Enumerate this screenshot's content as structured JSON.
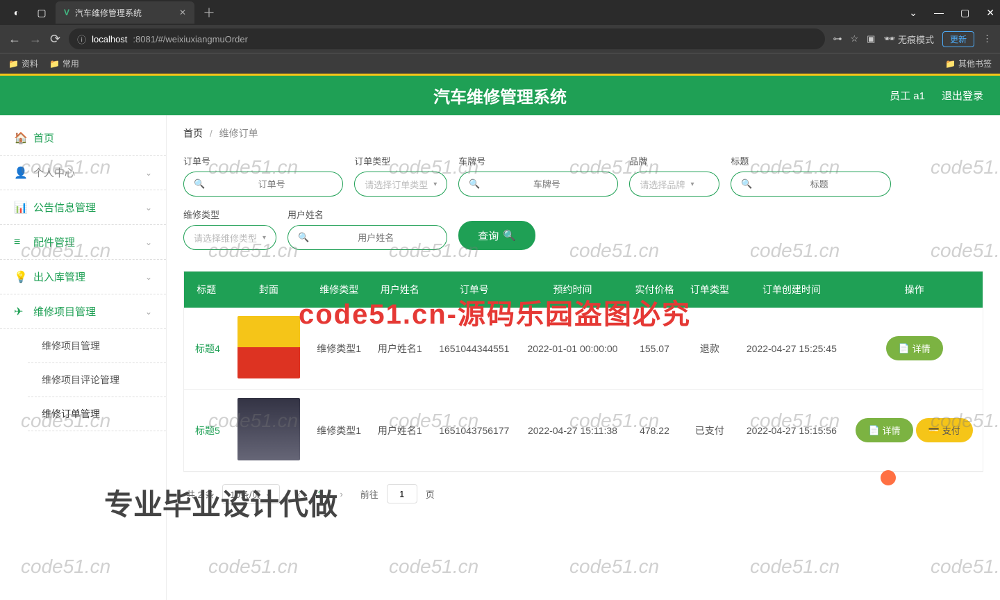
{
  "browser": {
    "tab_title": "汽车维修管理系统",
    "url_prefix": "localhost",
    "url_suffix": ":8081/#/weixiuxiangmuOrder",
    "incognito_label": "无痕模式",
    "update_label": "更新",
    "bookmarks": [
      "资料",
      "常用"
    ],
    "other_bookmarks": "其他书签"
  },
  "header": {
    "title": "汽车维修管理系统",
    "user_label": "员工 a1",
    "logout": "退出登录"
  },
  "sidebar": {
    "home": "首页",
    "items": [
      {
        "icon": "👤",
        "label": "个人中心"
      },
      {
        "icon": "📊",
        "label": "公告信息管理"
      },
      {
        "icon": "≡",
        "label": "配件管理"
      },
      {
        "icon": "💡",
        "label": "出入库管理"
      },
      {
        "icon": "✈",
        "label": "维修项目管理"
      }
    ],
    "sub": [
      "维修项目管理",
      "维修项目评论管理",
      "维修订单管理"
    ]
  },
  "breadcrumb": {
    "home": "首页",
    "current": "维修订单"
  },
  "search": {
    "fields": [
      {
        "label": "订单号",
        "placeholder": "订单号",
        "type": "text"
      },
      {
        "label": "订单类型",
        "placeholder": "请选择订单类型",
        "type": "select"
      },
      {
        "label": "车牌号",
        "placeholder": "车牌号",
        "type": "text"
      },
      {
        "label": "品牌",
        "placeholder": "请选择品牌",
        "type": "select"
      },
      {
        "label": "标题",
        "placeholder": "标题",
        "type": "text"
      },
      {
        "label": "维修类型",
        "placeholder": "请选择维修类型",
        "type": "select"
      },
      {
        "label": "用户姓名",
        "placeholder": "用户姓名",
        "type": "text"
      }
    ],
    "query_btn": "查询"
  },
  "table": {
    "headers": [
      "标题",
      "封面",
      "维修类型",
      "用户姓名",
      "订单号",
      "预约时间",
      "实付价格",
      "订单类型",
      "订单创建时间",
      "操作"
    ],
    "rows": [
      {
        "title": "标题4",
        "repair_type": "维修类型1",
        "user_name": "用户姓名1",
        "order_no": "1651044344551",
        "reserve_time": "2022-01-01 00:00:00",
        "price": "155.07",
        "order_type": "退款",
        "create_time": "2022-04-27 15:25:45",
        "ops": [
          "详情"
        ]
      },
      {
        "title": "标题5",
        "repair_type": "维修类型1",
        "user_name": "用户姓名1",
        "order_no": "1651043756177",
        "reserve_time": "2022-04-27 15:11:38",
        "price": "478.22",
        "order_type": "已支付",
        "create_time": "2022-04-27 15:15:56",
        "ops": [
          "详情",
          "支付"
        ]
      }
    ]
  },
  "pagination": {
    "total_label": "共 2 条",
    "page_size": "10条/页",
    "current": "1",
    "goto_prefix": "前往",
    "goto_value": "1",
    "goto_suffix": "页"
  },
  "watermarks": {
    "wm_text": "code51.cn",
    "red_text": "code51.cn-源码乐园盗图必究",
    "bottom_text": "专业毕业设计代做"
  }
}
